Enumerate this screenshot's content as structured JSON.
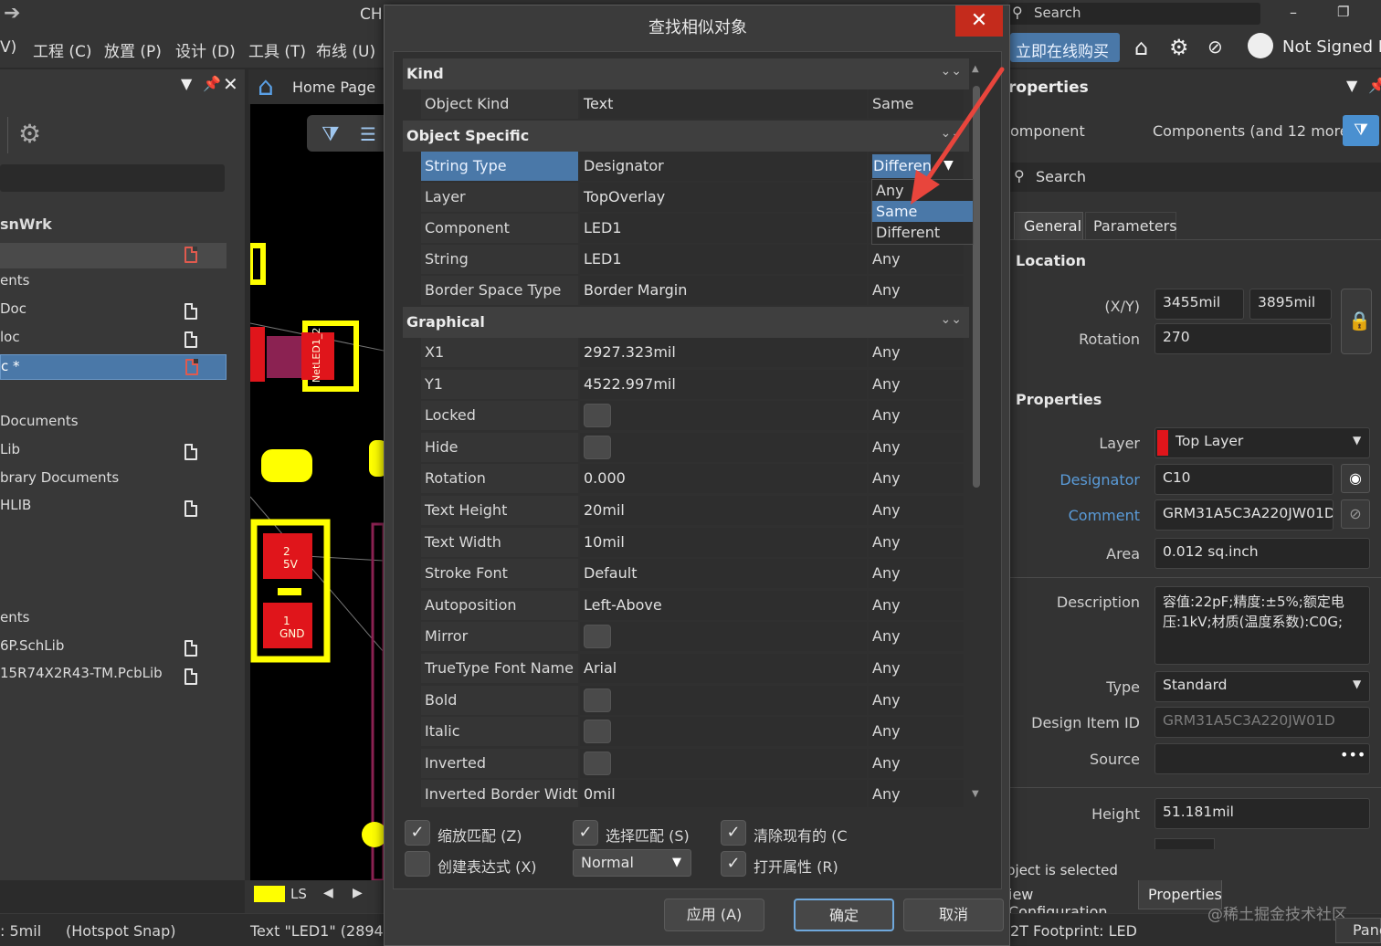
{
  "window": {
    "title_fragment": "CH",
    "search_placeholder": "Search"
  },
  "menu": [
    "V)",
    "工程 (C)",
    "放置 (P)",
    "设计 (D)",
    "工具 (T)",
    "布线 (U)"
  ],
  "top_right": {
    "buy": "立即在线购买",
    "user": "Not Signed In"
  },
  "left_panel": {
    "section": "snWrk",
    "items": [
      "ents",
      "Doc",
      "loc",
      "c *",
      "Documents",
      "Lib",
      "brary Documents",
      "HLIB",
      "ents",
      "6P.SchLib",
      "15R74X2R43-TM.PcbLib"
    ]
  },
  "canvas": {
    "tab": "Home Page",
    "layer_tab": "LS"
  },
  "dialog": {
    "title": "查找相似对象",
    "close": "✕",
    "categories": {
      "kind": "Kind",
      "object_specific": "Object Specific",
      "graphical": "Graphical"
    },
    "kind_rows": [
      {
        "name": "Object Kind",
        "value": "Text",
        "match": "Same"
      }
    ],
    "object_rows": [
      {
        "name": "String Type",
        "value": "Designator",
        "match": "Different"
      },
      {
        "name": "Layer",
        "value": "TopOverlay",
        "match": ""
      },
      {
        "name": "Component",
        "value": "LED1",
        "match": ""
      },
      {
        "name": "String",
        "value": "LED1",
        "match": "Any"
      },
      {
        "name": "Border Space Type",
        "value": "Border Margin",
        "match": "Any"
      }
    ],
    "graphical_rows": [
      {
        "name": "X1",
        "value": "2927.323mil",
        "match": "Any"
      },
      {
        "name": "Y1",
        "value": "4522.997mil",
        "match": "Any"
      },
      {
        "name": "Locked",
        "value": "",
        "match": "Any"
      },
      {
        "name": "Hide",
        "value": "",
        "match": "Any"
      },
      {
        "name": "Rotation",
        "value": "0.000",
        "match": "Any"
      },
      {
        "name": "Text Height",
        "value": "20mil",
        "match": "Any"
      },
      {
        "name": "Text Width",
        "value": "10mil",
        "match": "Any"
      },
      {
        "name": "Stroke Font",
        "value": "Default",
        "match": "Any"
      },
      {
        "name": "Autoposition",
        "value": "Left-Above",
        "match": "Any"
      },
      {
        "name": "Mirror",
        "value": "",
        "match": "Any"
      },
      {
        "name": "TrueType Font Name",
        "value": "Arial",
        "match": "Any"
      },
      {
        "name": "Bold",
        "value": "",
        "match": "Any"
      },
      {
        "name": "Italic",
        "value": "",
        "match": "Any"
      },
      {
        "name": "Inverted",
        "value": "",
        "match": "Any"
      },
      {
        "name": "Inverted Border Width",
        "value": "0mil",
        "match": "Any"
      }
    ],
    "dropdown_options": [
      "Any",
      "Same",
      "Different"
    ],
    "dropdown_highlight": "Same",
    "options": {
      "zoom_match": "缩放匹配 (Z)",
      "select_match": "选择匹配 (S)",
      "clear_existing": "清除现有的 (C",
      "create_expression": "创建表达式 (X)",
      "mode": "Normal",
      "open_properties": "打开属性 (R)"
    },
    "buttons": {
      "apply": "应用 (A)",
      "ok": "确定",
      "cancel": "取消"
    }
  },
  "properties": {
    "header": "roperties",
    "filter_label": "omponent",
    "filter_value": "Components (and 12 more)",
    "search": "Search",
    "tabs": [
      "General",
      "Parameters"
    ],
    "location": {
      "title": "Location",
      "xy_label": "(X/Y)",
      "x": "3455mil",
      "y": "3895mil",
      "rotation_label": "Rotation",
      "rotation": "270"
    },
    "props": {
      "title": "Properties",
      "layer_label": "Layer",
      "layer": "Top Layer",
      "designator_label": "Designator",
      "designator": "C10",
      "comment_label": "Comment",
      "comment": "GRM31A5C3A220JW01D",
      "area_label": "Area",
      "area": "0.012 sq.inch",
      "description_label": "Description",
      "description": "容值:22pF;精度:±5%;额定电压:1kV;材质(温度系数):C0G;",
      "type_label": "Type",
      "type": "Standard",
      "design_item_label": "Design Item ID",
      "design_item": "GRM31A5C3A220JW01D",
      "source_label": "Source",
      "source": "•••",
      "height_label": "Height",
      "height": "51.181mil"
    },
    "status": "bject is selected",
    "bottom_tabs": [
      "iew Configuration",
      "Properties"
    ]
  },
  "statusbar": {
    "grid": ": 5mil",
    "snap": "(Hotspot Snap)",
    "text": "Text \"LED1\" (2894mi",
    "footprint": "2T Footprint: LED",
    "panels": "Pane",
    "watermark": "@稀土掘金技术社区"
  },
  "colors": {
    "accent": "#4a78a8",
    "close": "#c42b1c",
    "layer_red": "#e0151b",
    "arrow": "#e8453c",
    "pcb_yellow": "#ffff00"
  }
}
